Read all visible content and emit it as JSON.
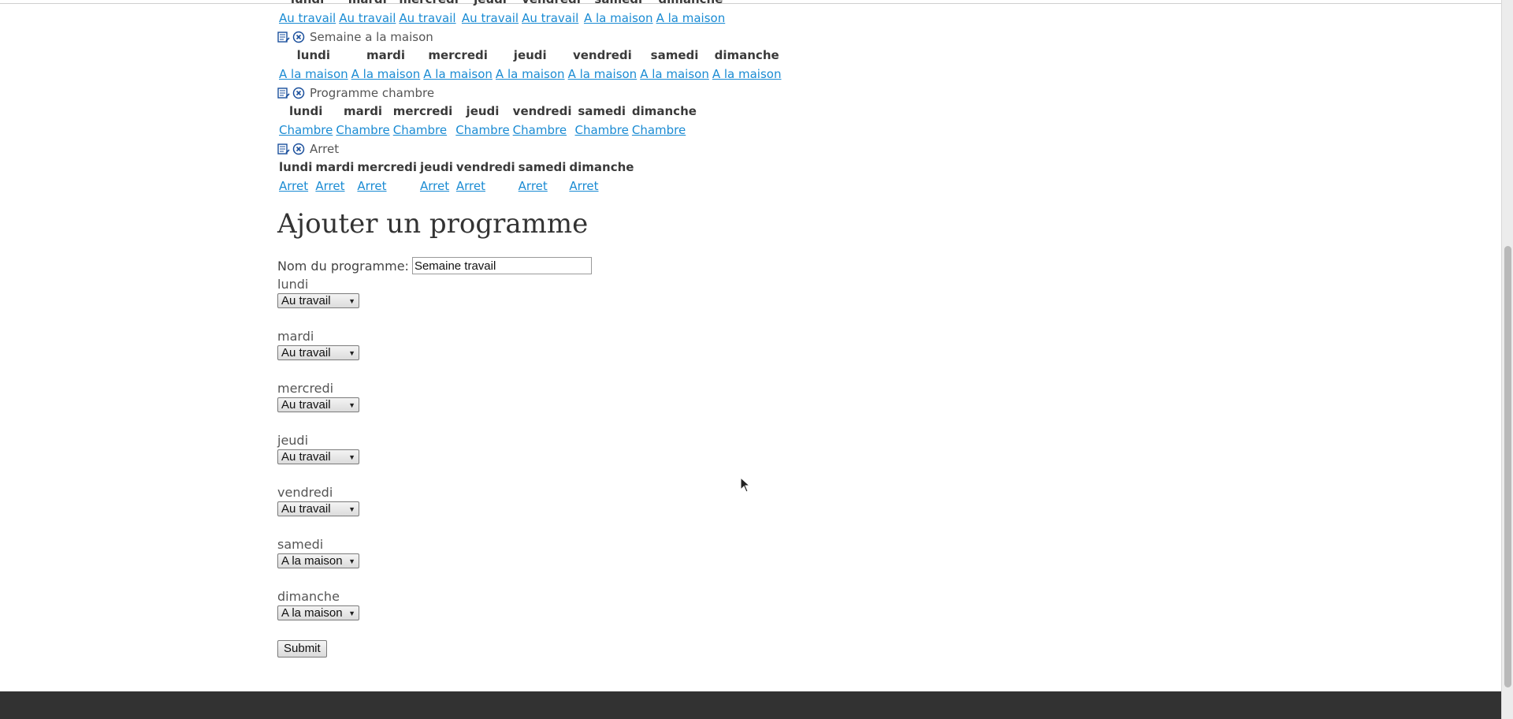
{
  "days": [
    "lundi",
    "mardi",
    "mercredi",
    "jeudi",
    "vendredi",
    "samedi",
    "dimanche"
  ],
  "programs": [
    {
      "name": "",
      "partial": true,
      "links": [
        "Au travail",
        "Au travail",
        "Au travail",
        "Au travail",
        "Au travail",
        "A la maison",
        "A la maison"
      ]
    },
    {
      "name": "Semaine a la maison",
      "links": [
        "A la maison",
        "A la maison",
        "A la maison",
        "A la maison",
        "A la maison",
        "A la maison",
        "A la maison"
      ]
    },
    {
      "name": "Programme chambre",
      "links": [
        "Chambre",
        "Chambre",
        "Chambre",
        "Chambre",
        "Chambre",
        "Chambre",
        "Chambre"
      ]
    },
    {
      "name": "Arret",
      "links": [
        "Arret",
        "Arret",
        "Arret",
        "Arret",
        "Arret",
        "Arret",
        "Arret"
      ]
    }
  ],
  "add_form": {
    "title": "Ajouter un programme",
    "name_label": "Nom du programme:",
    "name_value": "Semaine travail",
    "day_fields": [
      {
        "label": "lundi",
        "selected": "Au travail"
      },
      {
        "label": "mardi",
        "selected": "Au travail"
      },
      {
        "label": "mercredi",
        "selected": "Au travail"
      },
      {
        "label": "jeudi",
        "selected": "Au travail"
      },
      {
        "label": "vendredi",
        "selected": "Au travail"
      },
      {
        "label": "samedi",
        "selected": "A la maison"
      },
      {
        "label": "dimanche",
        "selected": "A la maison"
      }
    ],
    "submit_label": "Submit"
  },
  "colors": {
    "link": "#1a8bd3",
    "footer": "#323232"
  }
}
